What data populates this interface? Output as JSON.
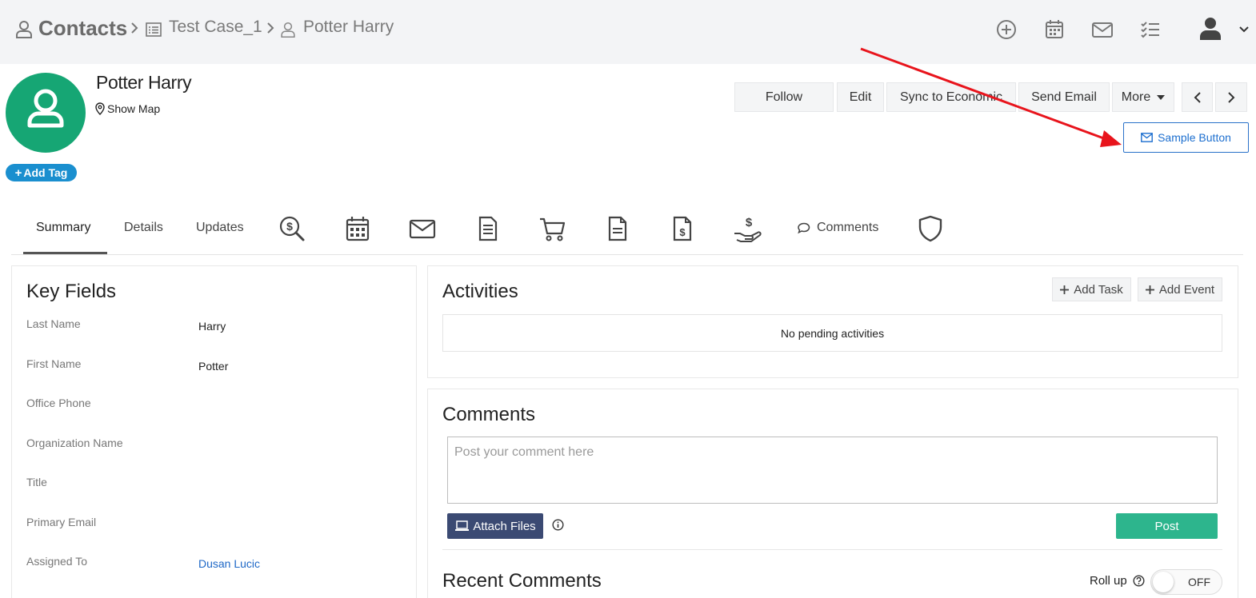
{
  "breadcrumb": {
    "module": "Contacts",
    "parent": "Test Case_1",
    "record": "Potter Harry"
  },
  "record": {
    "title": "Potter Harry",
    "show_map_label": "Show Map",
    "add_tag_label": "Add Tag"
  },
  "actions": {
    "follow": "Follow",
    "edit": "Edit",
    "sync": "Sync to Economic",
    "send_email": "Send Email",
    "more": "More",
    "sample_button": "Sample Button"
  },
  "tabs": {
    "summary": "Summary",
    "details": "Details",
    "updates": "Updates",
    "comments": "Comments"
  },
  "key_fields": {
    "title": "Key Fields",
    "fields": [
      {
        "label": "Last Name",
        "value": "Harry"
      },
      {
        "label": "First Name",
        "value": "Potter"
      },
      {
        "label": "Office Phone",
        "value": ""
      },
      {
        "label": "Organization Name",
        "value": ""
      },
      {
        "label": "Title",
        "value": ""
      },
      {
        "label": "Primary Email",
        "value": ""
      },
      {
        "label": "Assigned To",
        "value": "Dusan Lucic"
      }
    ]
  },
  "activities": {
    "title": "Activities",
    "add_task": "Add Task",
    "add_event": "Add Event",
    "empty_text": "No pending activities"
  },
  "comments": {
    "title": "Comments",
    "placeholder": "Post your comment here",
    "attach_label": "Attach Files",
    "post_label": "Post",
    "recent_title": "Recent Comments",
    "rollup_label": "Roll up",
    "toggle_state": "OFF"
  },
  "colors": {
    "avatar": "#16a674",
    "tag": "#1a8fcf",
    "attach": "#3b4a73",
    "post": "#2db58d",
    "link": "#1d67c6",
    "annotation_arrow": "#e8141c"
  },
  "icons": [
    "user-icon",
    "list-icon",
    "plus-circle-icon",
    "calendar-icon",
    "mail-icon",
    "checklist-icon",
    "account-icon",
    "location-pin-icon",
    "search-dollar-icon",
    "cart-icon",
    "document-icon",
    "invoice-icon",
    "hand-dollar-icon",
    "comment-icon",
    "shield-icon",
    "laptop-icon",
    "info-icon",
    "help-circle-icon"
  ]
}
